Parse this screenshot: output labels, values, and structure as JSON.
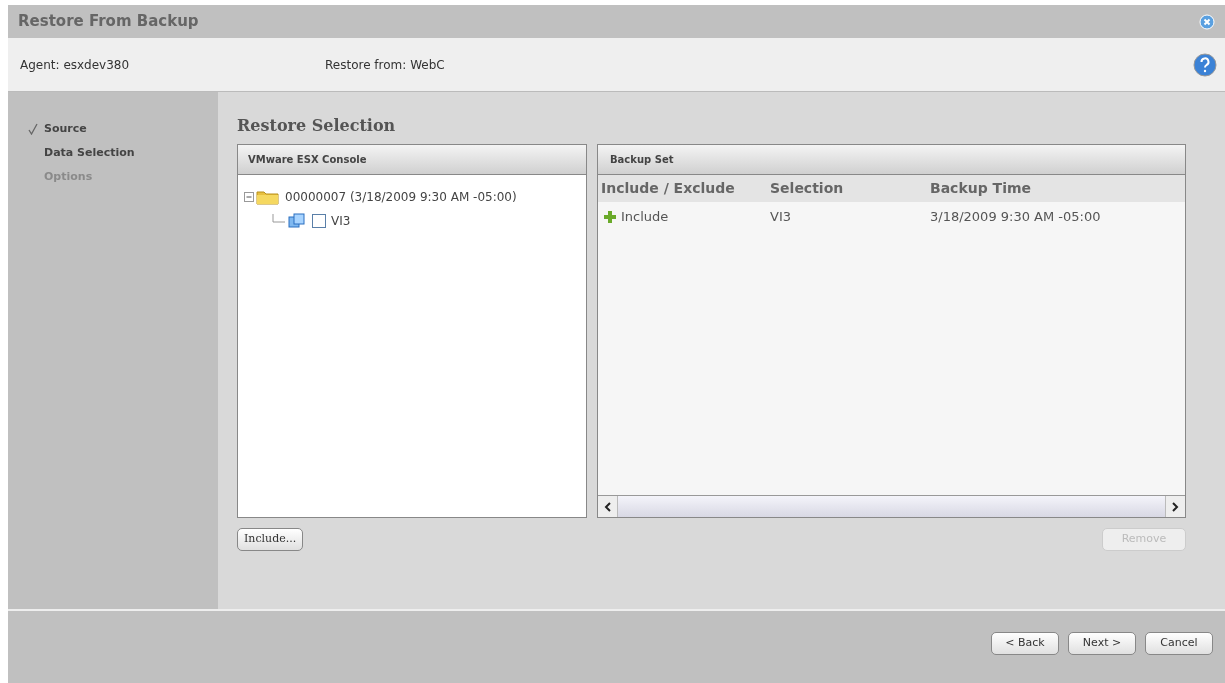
{
  "window": {
    "title": "Restore From Backup"
  },
  "header": {
    "agent": "Agent: esxdev380",
    "restore_from": "Restore from: WebC"
  },
  "steps": [
    {
      "label": "Source",
      "checked": true,
      "disabled": false
    },
    {
      "label": "Data Selection",
      "checked": false,
      "disabled": false
    },
    {
      "label": "Options",
      "checked": false,
      "disabled": true
    }
  ],
  "section_title": "Restore Selection",
  "tree_panel": {
    "title": "VMware ESX Console",
    "nodes": [
      {
        "kind": "folder",
        "label": "00000007 (3/18/2009 9:30 AM -05:00)",
        "expanded": true,
        "children": [
          {
            "kind": "vm",
            "label": "VI3",
            "checked": false
          }
        ]
      }
    ]
  },
  "backup_set": {
    "title": "Backup Set",
    "columns": [
      "Include / Exclude",
      "Selection",
      "Backup Time"
    ],
    "rows": [
      {
        "action": "Include",
        "selection": "VI3",
        "time": "3/18/2009 9:30 AM -05:00"
      }
    ]
  },
  "include_button": {
    "label": "Include...",
    "disabled": false
  },
  "remove_button": {
    "label": "Remove",
    "disabled": true
  },
  "footer_buttons": [
    {
      "label": "< Back",
      "disabled": false
    },
    {
      "label": "Next >",
      "disabled": false
    },
    {
      "label": "Cancel",
      "disabled": false
    }
  ]
}
